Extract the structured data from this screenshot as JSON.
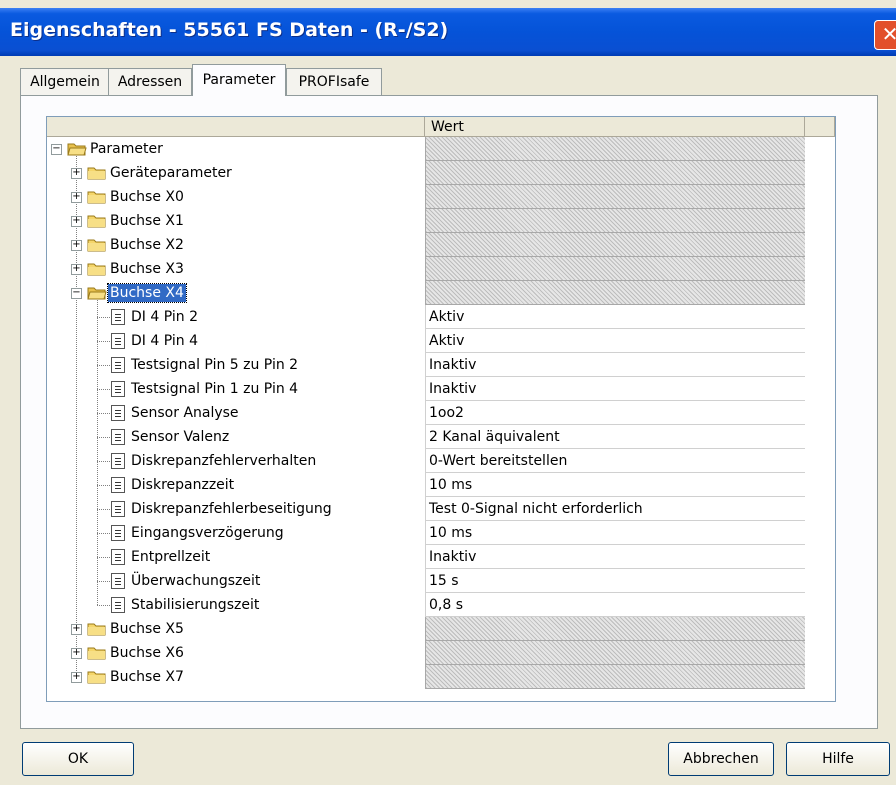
{
  "window": {
    "title": "Eigenschaften - 55561 FS Daten - (R-/S2)",
    "close_label": "✕"
  },
  "tabs": [
    {
      "label": "Allgemein"
    },
    {
      "label": "Adressen"
    },
    {
      "label": "Parameter",
      "active": true
    },
    {
      "label": "PROFIsafe"
    }
  ],
  "grid": {
    "column_value": "Wert"
  },
  "tree": {
    "root": "Parameter",
    "groups_before": [
      "Geräteparameter",
      "Buchse X0",
      "Buchse X1",
      "Buchse X2",
      "Buchse X3"
    ],
    "expanded_group": "Buchse X4",
    "params": [
      {
        "name": "DI 4 Pin 2",
        "value": "Aktiv"
      },
      {
        "name": "DI 4 Pin 4",
        "value": "Aktiv"
      },
      {
        "name": "Testsignal Pin 5 zu Pin 2",
        "value": "Inaktiv"
      },
      {
        "name": "Testsignal Pin 1 zu Pin 4",
        "value": "Inaktiv"
      },
      {
        "name": "Sensor Analyse",
        "value": "1oo2"
      },
      {
        "name": "Sensor Valenz",
        "value": "2 Kanal äquivalent"
      },
      {
        "name": "Diskrepanzfehlerverhalten",
        "value": "0-Wert bereitstellen"
      },
      {
        "name": "Diskrepanzzeit",
        "value": "10 ms"
      },
      {
        "name": "Diskrepanzfehlerbeseitigung",
        "value": "Test 0-Signal nicht erforderlich"
      },
      {
        "name": "Eingangsverzögerung",
        "value": "10 ms"
      },
      {
        "name": "Entprellzeit",
        "value": "Inaktiv"
      },
      {
        "name": "Überwachungszeit",
        "value": "15 s"
      },
      {
        "name": "Stabilisierungszeit",
        "value": "0,8 s"
      }
    ],
    "groups_after": [
      "Buchse X5",
      "Buchse X6",
      "Buchse X7"
    ]
  },
  "buttons": {
    "ok": "OK",
    "cancel": "Abbrechen",
    "help": "Hilfe"
  },
  "colors": {
    "titlebar": "#0553d8",
    "selection": "#316ac5",
    "folder": "#f5d66b",
    "dialog_bg": "#ece9d8"
  }
}
